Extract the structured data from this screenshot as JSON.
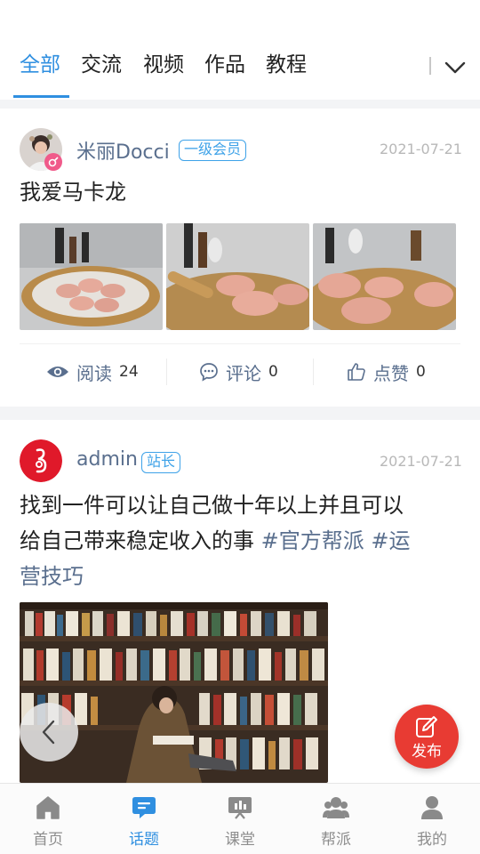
{
  "tabs": [
    "全部",
    "交流",
    "视频",
    "作品",
    "教程"
  ],
  "posts": [
    {
      "username": "米丽Docci",
      "badge": "一级会员",
      "date": "2021-07-21",
      "title": "我爱马卡龙",
      "actions": {
        "read_label": "阅读",
        "read_count": "24",
        "comment_label": "评论",
        "comment_count": "0",
        "like_label": "点赞",
        "like_count": "0"
      }
    },
    {
      "username": "admin",
      "badge": "站长",
      "date": "2021-07-21",
      "title_lines": [
        "找到一件可以让自己做十年以上并且可以",
        "给自己带来稳定收入的事"
      ],
      "tag1": "#官方帮派",
      "tag2_part1": "#运",
      "tag2_part2": "营技巧"
    }
  ],
  "fab_label": "发布",
  "bottom_nav": [
    "首页",
    "话题",
    "课堂",
    "帮派",
    "我的"
  ],
  "colors": {
    "accent": "#2f8fe0",
    "fab": "#e83b33",
    "username": "#5a6f8e"
  }
}
